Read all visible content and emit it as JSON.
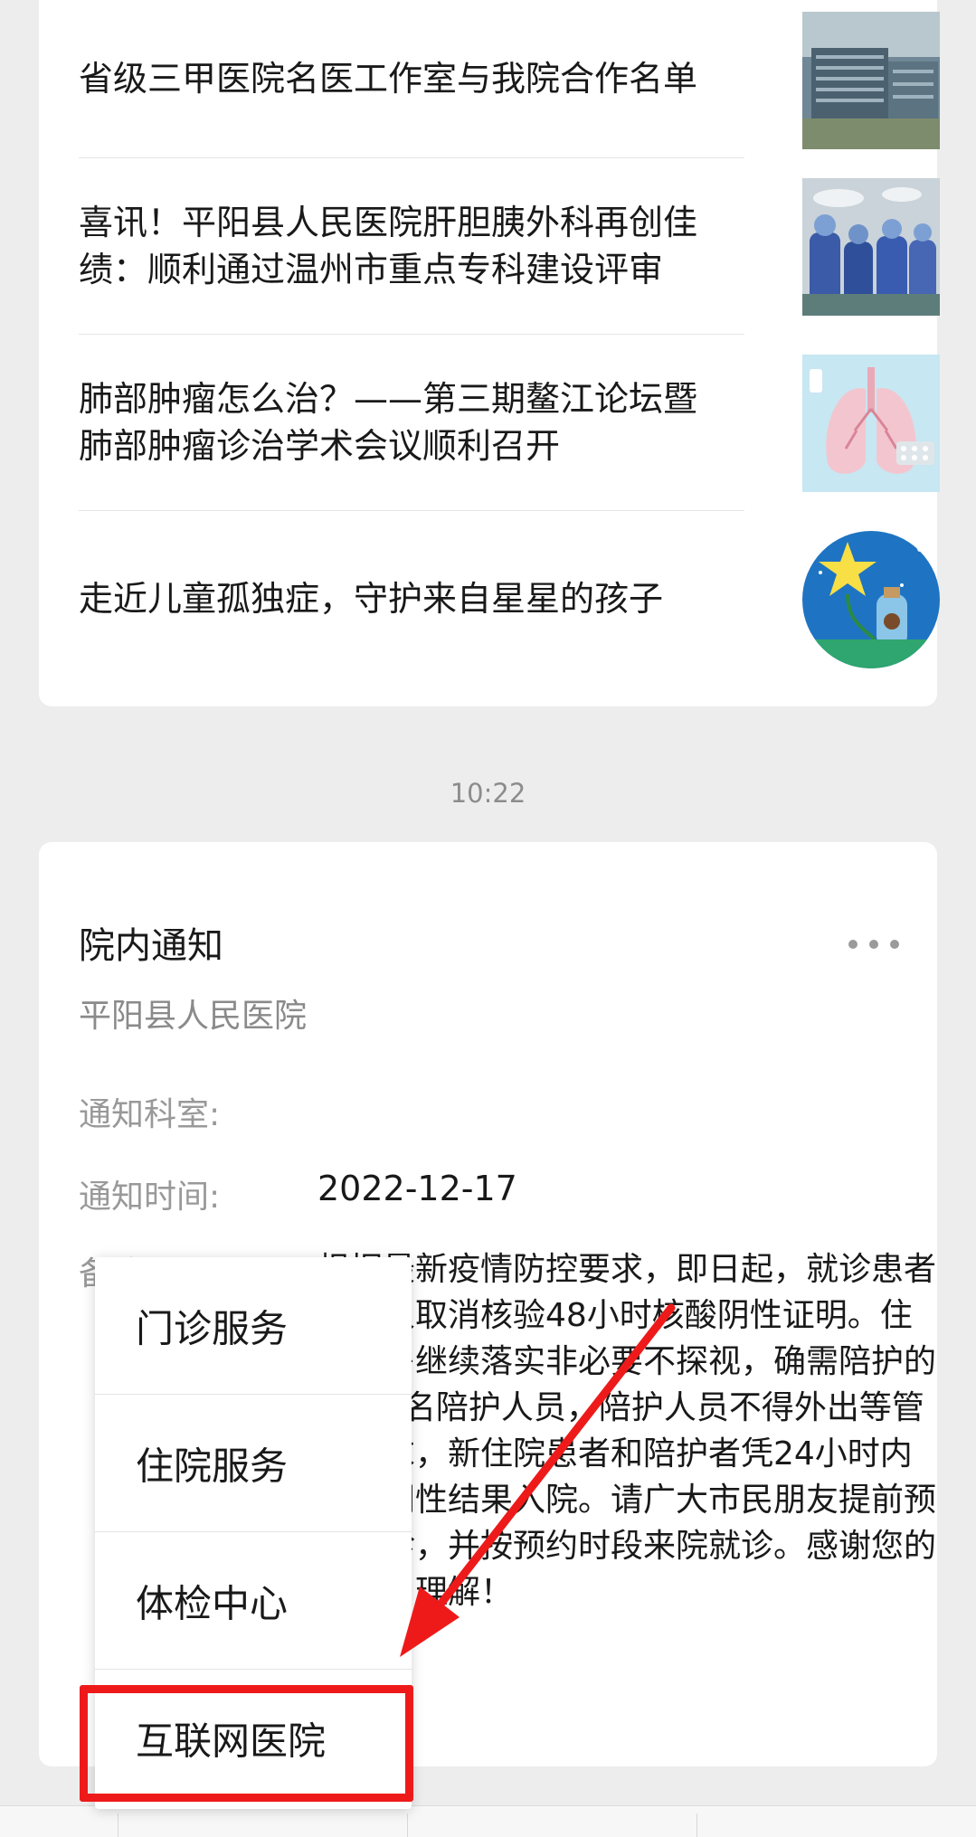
{
  "articles": [
    {
      "title": "省级三甲医院名医工作室与我院合作名单",
      "thumb_icon": "hospital-building-photo"
    },
    {
      "title": "喜讯！平阳县人民医院肝胆胰外科再创佳绩：顺利通过温州市重点专科建设评审",
      "thumb_icon": "surgery-team-photo"
    },
    {
      "title": "肺部肿瘤怎么治？——第三期鳌江论坛暨肺部肿瘤诊治学术会议顺利召开",
      "thumb_icon": "lungs-illustration"
    },
    {
      "title": "走近儿童孤独症，守护来自星星的孩子",
      "thumb_icon": "star-bottle-illustration"
    }
  ],
  "timestamp": "10:22",
  "notice": {
    "title": "院内通知",
    "org": "平阳县人民医院",
    "dept_label": "通知科室:",
    "dept_value": "",
    "time_label": "通知时间:",
    "time_value": "2022-12-17",
    "remark_label": "备注:",
    "remark_value": "根据最新疫情防控要求，即日起，就诊患者及陪人取消核验48小时核酸阴性证明。住院病房继续落实非必要不探视，确需陪护的固定1名陪护人员，陪护人员不得外出等管理要求，新住院患者和陪护者凭24小时内检测阴性结果入院。请广大市民朋友提前预约门诊，并按预约时段来院就诊。感谢您的支持与理解！"
  },
  "menu": {
    "items": [
      "门诊服务",
      "住院服务",
      "体检中心",
      "互联网医院"
    ]
  },
  "colors": {
    "highlight": "#ee1a1a",
    "background": "#ededed",
    "card": "#ffffff"
  }
}
